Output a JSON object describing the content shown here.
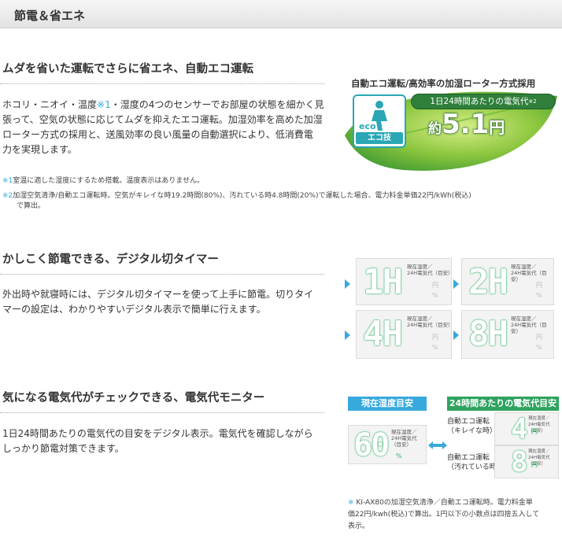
{
  "header": {
    "title": "節電＆省エネ"
  },
  "section1": {
    "title": "ムダを省いた運転でさらに省エネ、自動エコ運転",
    "body_pre": "ホコリ・ニオイ・温度",
    "body_mark": "※1",
    "body_line1_post": "・湿度の4つのセンサーでお部屋の状態を細かく見",
    "body_line2": "張って、空気の状態に応じてムダを抑えたエコ運転。加湿効率を高めた加湿",
    "body_line3": "ローター方式の採用と、送風効率の良い風量の自動選択により、低消費電",
    "body_line4": "力を実現します。",
    "note1_mark": "※1",
    "note1_text": "室温に適した湿度にするため搭載。温度表示はありません。",
    "note2_mark": "※2",
    "note2_text": "加湿空気清浄/自動エコ運転時。空気がキレイな時19.2時間(80%)、汚れている時4.8時間(20%)で運転した場合、電力料金単価22円/kWh(税込)",
    "note2_text2": "で算出。",
    "eco_heading": "自動エコ運転/高効率の加湿ローター方式採用",
    "eco_badge_label": "エコ技",
    "eco_badge_letters": "eco",
    "cost_caption": "1日24時間あたりの電気代",
    "cost_caption_mark": "※2",
    "cost_prefix": "約",
    "cost_number": "5.1",
    "cost_unit": "円"
  },
  "section2": {
    "title": "かしこく節電できる、デジタル切タイマー",
    "body_line1": "外出時や就寝時には、デジタル切タイマーを使って上手に節電。切りタイ",
    "body_line2": "マーの設定は、わかりやすいデジタル表示で簡単に行えます。",
    "panel_label_line1": "現在湿度／",
    "panel_label_line2": "24H電気代（目安）",
    "panel_unit_yen": "円",
    "panel_unit_pct": "%",
    "timers": [
      "1H",
      "2H",
      "4H",
      "8H"
    ]
  },
  "section3": {
    "title": "気になる電気代がチェックできる、電気代モニター",
    "body_line1": "1日24時間あたりの電気代の目安をデジタル表示。電気代を確認しながら",
    "body_line2": "しっかり節電対策できます。",
    "tag_humidity": "現在湿度目安",
    "tag_cost": "24時間あたりの電気代目安",
    "humidity_value": "60",
    "humidity_unit": "%",
    "panel_label_line1": "現在湿度／",
    "panel_label_line2": "24H電気代（目安）",
    "modes": [
      {
        "line1": "自動エコ運転",
        "line2": "（キレイな時）",
        "value": "4",
        "unit": "円"
      },
      {
        "line1": "自動エコ運転",
        "line2": "（汚れている時）",
        "value": "8",
        "unit": "円"
      }
    ],
    "footnote_mark": "※",
    "footnote_line1": "KI-AX80の加湿空気清浄／自動エコ運転時。電力料金単",
    "footnote_line2": "価22円/kwh(税込)で算出。1円以下の小数点は四捨五入して",
    "footnote_line3": "表示。"
  },
  "colors": {
    "accent_blue": "#38a9dd",
    "digit_green": "#2fb567",
    "leaf_green": "#3fa046",
    "tag_green": "#2fa35f"
  }
}
